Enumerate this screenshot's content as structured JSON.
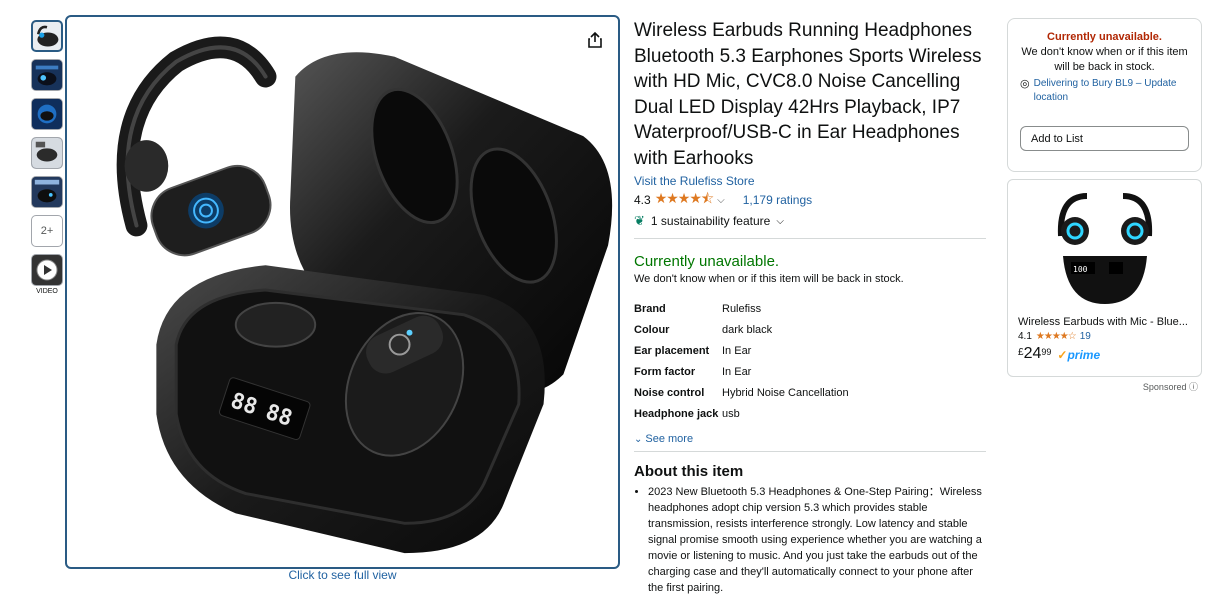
{
  "thumbnails": {
    "more_label": "2+",
    "video_label": "VIDEO"
  },
  "image": {
    "full_view_label": "Click to see full view"
  },
  "product": {
    "title": "Wireless Earbuds Running Headphones Bluetooth 5.3 Earphones Sports Wireless with HD Mic, CVC8.0 Noise Cancelling Dual LED Display 42Hrs Playback, IP7 Waterproof/USB-C in Ear Headphones with Earhooks",
    "store_link": "Visit the Rulefiss Store",
    "rating": "4.3",
    "stars": "★★★★⯪",
    "ratings_count": "1,179 ratings",
    "sustainability": "1 sustainability feature",
    "availability": "Currently unavailable.",
    "availability_sub": "We don't know when or if this item will be back in stock.",
    "specs": [
      {
        "key": "Brand",
        "value": "Rulefiss"
      },
      {
        "key": "Colour",
        "value": "dark black"
      },
      {
        "key": "Ear placement",
        "value": "In Ear"
      },
      {
        "key": "Form factor",
        "value": "In Ear"
      },
      {
        "key": "Noise control",
        "value": "Hybrid Noise Cancellation"
      },
      {
        "key": "Headphone jack",
        "value": "usb"
      }
    ],
    "see_more": "See more",
    "about_title": "About this item",
    "about_items": [
      "2023 New Bluetooth 5.3 Headphones & One-Step Pairing：Wireless headphones adopt chip version 5.3 which provides stable transmission, resists interference strongly. Low latency and stable signal promise smooth using experience whether you are watching a movie or listening to music. And you just take the earbuds out of the charging case and they'll automatically connect to your phone after the first pairing."
    ]
  },
  "buybox": {
    "unavailable": "Currently unavailable.",
    "sub": "We don't know when or if this item will be back in stock.",
    "deliver": "Delivering to Bury BL9 – Update location",
    "add_to_list": "Add to List"
  },
  "ad": {
    "title": "Wireless Earbuds with Mic - Blue...",
    "rating": "4.1",
    "stars": "★★★★☆",
    "count": "19",
    "currency": "£",
    "price_whole": "24",
    "price_frac": "99",
    "prime": "prime",
    "sponsored": "Sponsored"
  },
  "colors": {
    "link": "#2162a1",
    "available_green": "#007600",
    "unavailable_red": "#b12704",
    "star": "#de7921",
    "selected_border": "#2a5b84"
  }
}
